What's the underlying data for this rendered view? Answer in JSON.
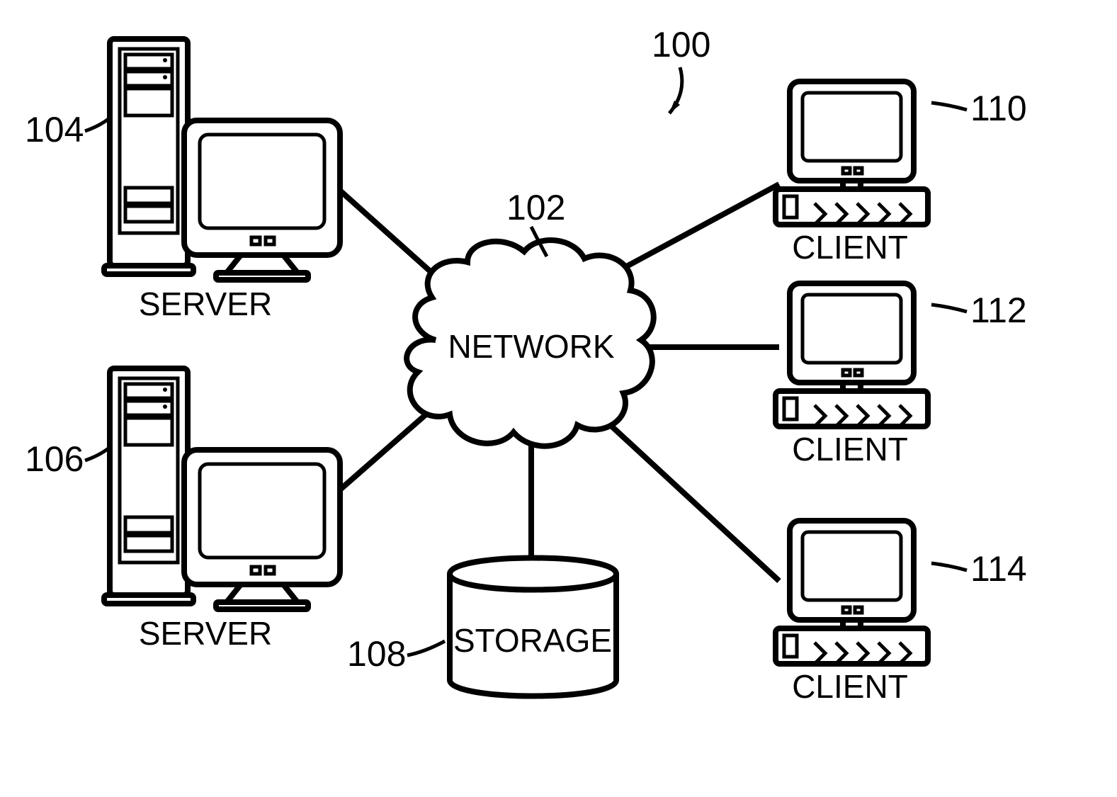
{
  "diagram": {
    "title_ref": "100",
    "network": {
      "label": "NETWORK",
      "ref": "102"
    },
    "storage": {
      "label": "STORAGE",
      "ref": "108"
    },
    "servers": [
      {
        "label": "SERVER",
        "ref": "104"
      },
      {
        "label": "SERVER",
        "ref": "106"
      }
    ],
    "clients": [
      {
        "label": "CLIENT",
        "ref": "110"
      },
      {
        "label": "CLIENT",
        "ref": "112"
      },
      {
        "label": "CLIENT",
        "ref": "114"
      }
    ]
  }
}
